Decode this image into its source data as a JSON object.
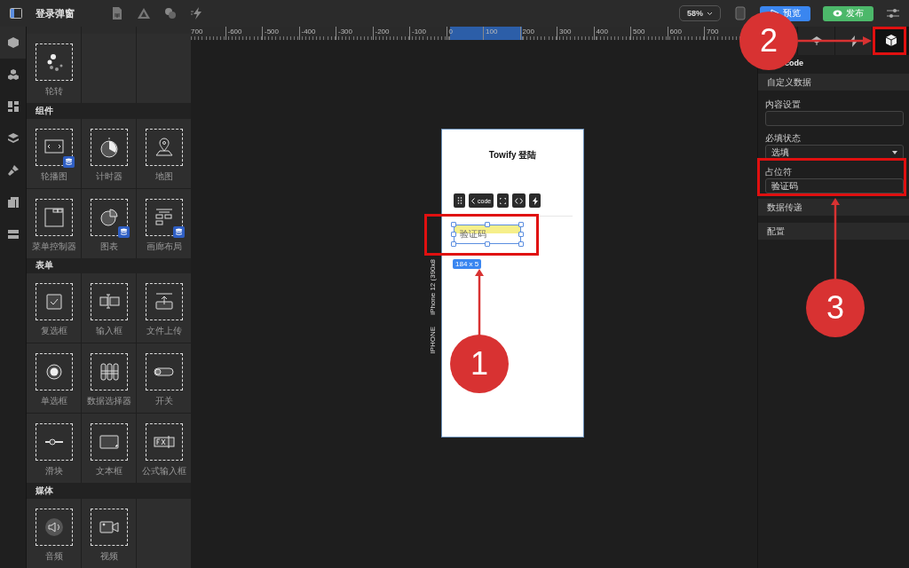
{
  "topbar": {
    "title": "登录弹窗",
    "zoom": "58%",
    "buttons": [
      {
        "label": "预览",
        "kind": "preview"
      },
      {
        "label": "发布",
        "kind": "publish"
      }
    ]
  },
  "rail": [
    {
      "kind": "cube",
      "selected": true
    },
    {
      "kind": "cubes",
      "selected": false
    },
    {
      "kind": "layout",
      "selected": false
    },
    {
      "kind": "layers",
      "selected": false
    },
    {
      "kind": "brush",
      "selected": false
    },
    {
      "kind": "panels",
      "selected": false
    },
    {
      "kind": "list",
      "selected": false
    }
  ],
  "palette": {
    "top_items": [
      {
        "label": "轮转",
        "kind": "spinner",
        "data_badge": false
      }
    ],
    "sections": [
      {
        "title": "组件",
        "items": [
          {
            "label": "轮播图",
            "kind": "carousel",
            "data_badge": true
          },
          {
            "label": "计时器",
            "kind": "timer",
            "data_badge": false
          },
          {
            "label": "地图",
            "kind": "map",
            "data_badge": false
          },
          {
            "label": "菜单控制器",
            "kind": "menu",
            "data_badge": false
          },
          {
            "label": "图表",
            "kind": "chart",
            "data_badge": true
          },
          {
            "label": "画廊布局",
            "kind": "gallery",
            "data_badge": true
          }
        ]
      },
      {
        "title": "表单",
        "items": [
          {
            "label": "复选框",
            "kind": "checkbox",
            "data_badge": false
          },
          {
            "label": "输入框",
            "kind": "input",
            "data_badge": false
          },
          {
            "label": "文件上传",
            "kind": "upload",
            "data_badge": false
          },
          {
            "label": "单选框",
            "kind": "radio",
            "data_badge": false
          },
          {
            "label": "数据选择器",
            "kind": "picker",
            "data_badge": false
          },
          {
            "label": "开关",
            "kind": "switch",
            "data_badge": false
          },
          {
            "label": "滑块",
            "kind": "slider",
            "data_badge": false
          },
          {
            "label": "文本框",
            "kind": "textarea",
            "data_badge": false
          },
          {
            "label": "公式输入框",
            "kind": "formula",
            "data_badge": false
          }
        ]
      },
      {
        "title": "媒体",
        "items": [
          {
            "label": "音频",
            "kind": "audio",
            "data_badge": false
          },
          {
            "label": "视频",
            "kind": "video",
            "data_badge": false
          }
        ]
      }
    ]
  },
  "ruler": {
    "labels": [
      "700",
      "-600",
      "-500",
      "-400",
      "-300",
      "-200",
      "-100",
      "0",
      "100",
      "200",
      "300",
      "400",
      "500",
      "600",
      "700"
    ]
  },
  "canvas": {
    "device_labels": [
      "iPhone 12 (390x8",
      "IPHONE"
    ],
    "page": {
      "title": "Towify 登陆",
      "toolbar": [
        {
          "kind": "grip"
        },
        {
          "kind": "back",
          "label": "code"
        },
        {
          "kind": "expand"
        },
        {
          "kind": "code"
        },
        {
          "kind": "bolt"
        }
      ],
      "input": {
        "placeholder": "验证码",
        "selected": true
      },
      "size_badge": "184 x 5"
    }
  },
  "inspector": {
    "tabs": [
      {
        "kind": "layers",
        "selected": false
      },
      {
        "kind": "bolt",
        "selected": false
      },
      {
        "kind": "cube",
        "selected": true
      }
    ],
    "component": "code",
    "rows": [
      {
        "kind": "header",
        "title": "自定义数据"
      },
      {
        "kind": "field",
        "label": "内容设置"
      },
      {
        "kind": "select",
        "label": "必填状态",
        "value": "选填"
      },
      {
        "kind": "field",
        "label": "占位符",
        "value": "验证码"
      },
      {
        "kind": "header",
        "title": "数据传递"
      },
      {
        "kind": "header",
        "title": "配置"
      }
    ]
  },
  "annotations": [
    {
      "number": "1"
    },
    {
      "number": "2"
    },
    {
      "number": "3"
    }
  ]
}
